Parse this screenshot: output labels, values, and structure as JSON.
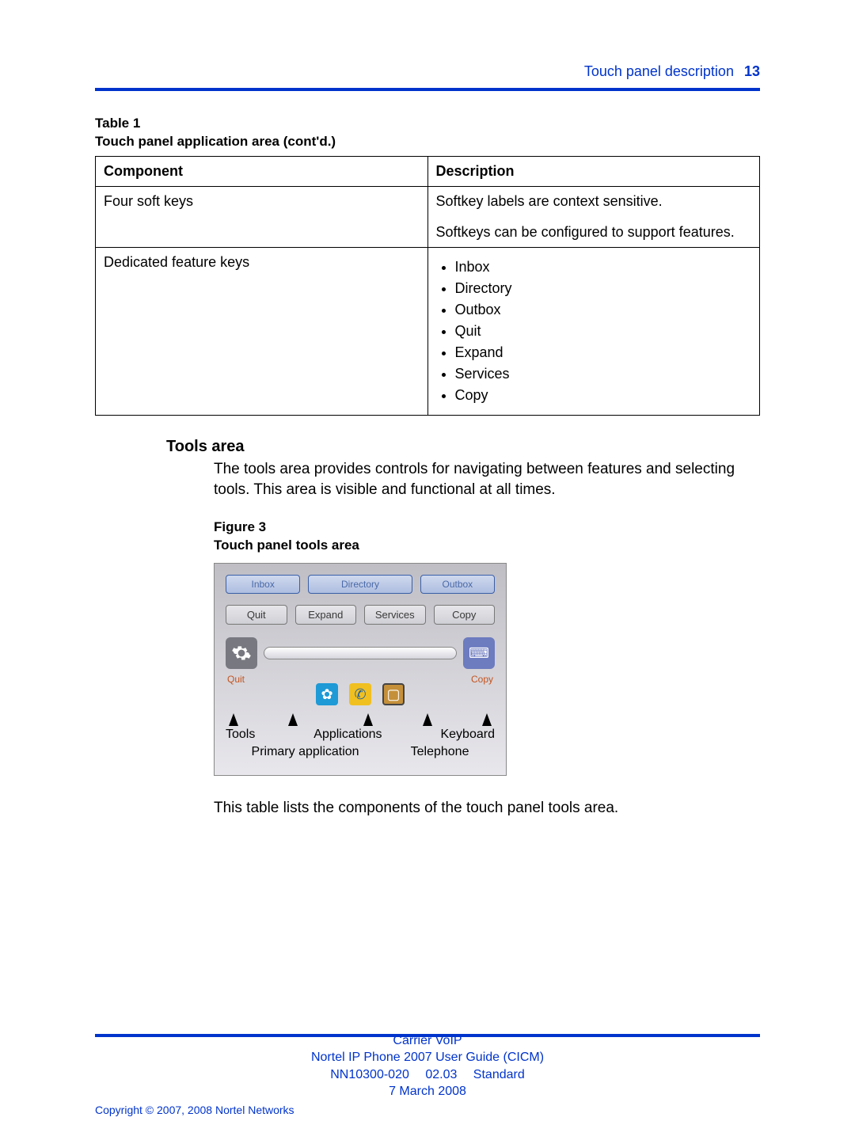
{
  "header": {
    "section": "Touch panel description",
    "page": "13"
  },
  "table": {
    "caption_a": "Table 1",
    "caption_b": "Touch panel application area (cont'd.)",
    "head": {
      "c1": "Component",
      "c2": "Description"
    },
    "row1": {
      "component": "Four soft keys",
      "desc_a": "Softkey labels are context sensitive.",
      "desc_b": "Softkeys can be configured to support features."
    },
    "row2": {
      "component": "Dedicated feature keys",
      "items": [
        "Inbox",
        "Directory",
        "Outbox",
        "Quit",
        "Expand",
        "Services",
        "Copy"
      ]
    }
  },
  "tools": {
    "heading": "Tools area",
    "para": "The tools area provides controls for navigating between features and selecting tools. This area is visible and functional at all times.",
    "fig_a": "Figure 3",
    "fig_b": "Touch panel tools area",
    "intro": "This table lists the components of the touch panel tools area."
  },
  "figure": {
    "soft": [
      "Inbox",
      "Directory",
      "Outbox"
    ],
    "btn": [
      "Quit",
      "Expand",
      "Services",
      "Copy"
    ],
    "quit": "Quit",
    "copy": "Copy",
    "lab": [
      "Tools",
      "Applications",
      "Keyboard"
    ],
    "lab2": [
      "Primary application",
      "Telephone"
    ]
  },
  "footer": {
    "l1": "Carrier VoIP",
    "l2": "Nortel IP Phone 2007 User Guide (CICM)",
    "l3": "NN10300-020  02.03  Standard",
    "l4": "7 March 2008",
    "copyright": "Copyright © 2007, 2008 Nortel Networks"
  }
}
